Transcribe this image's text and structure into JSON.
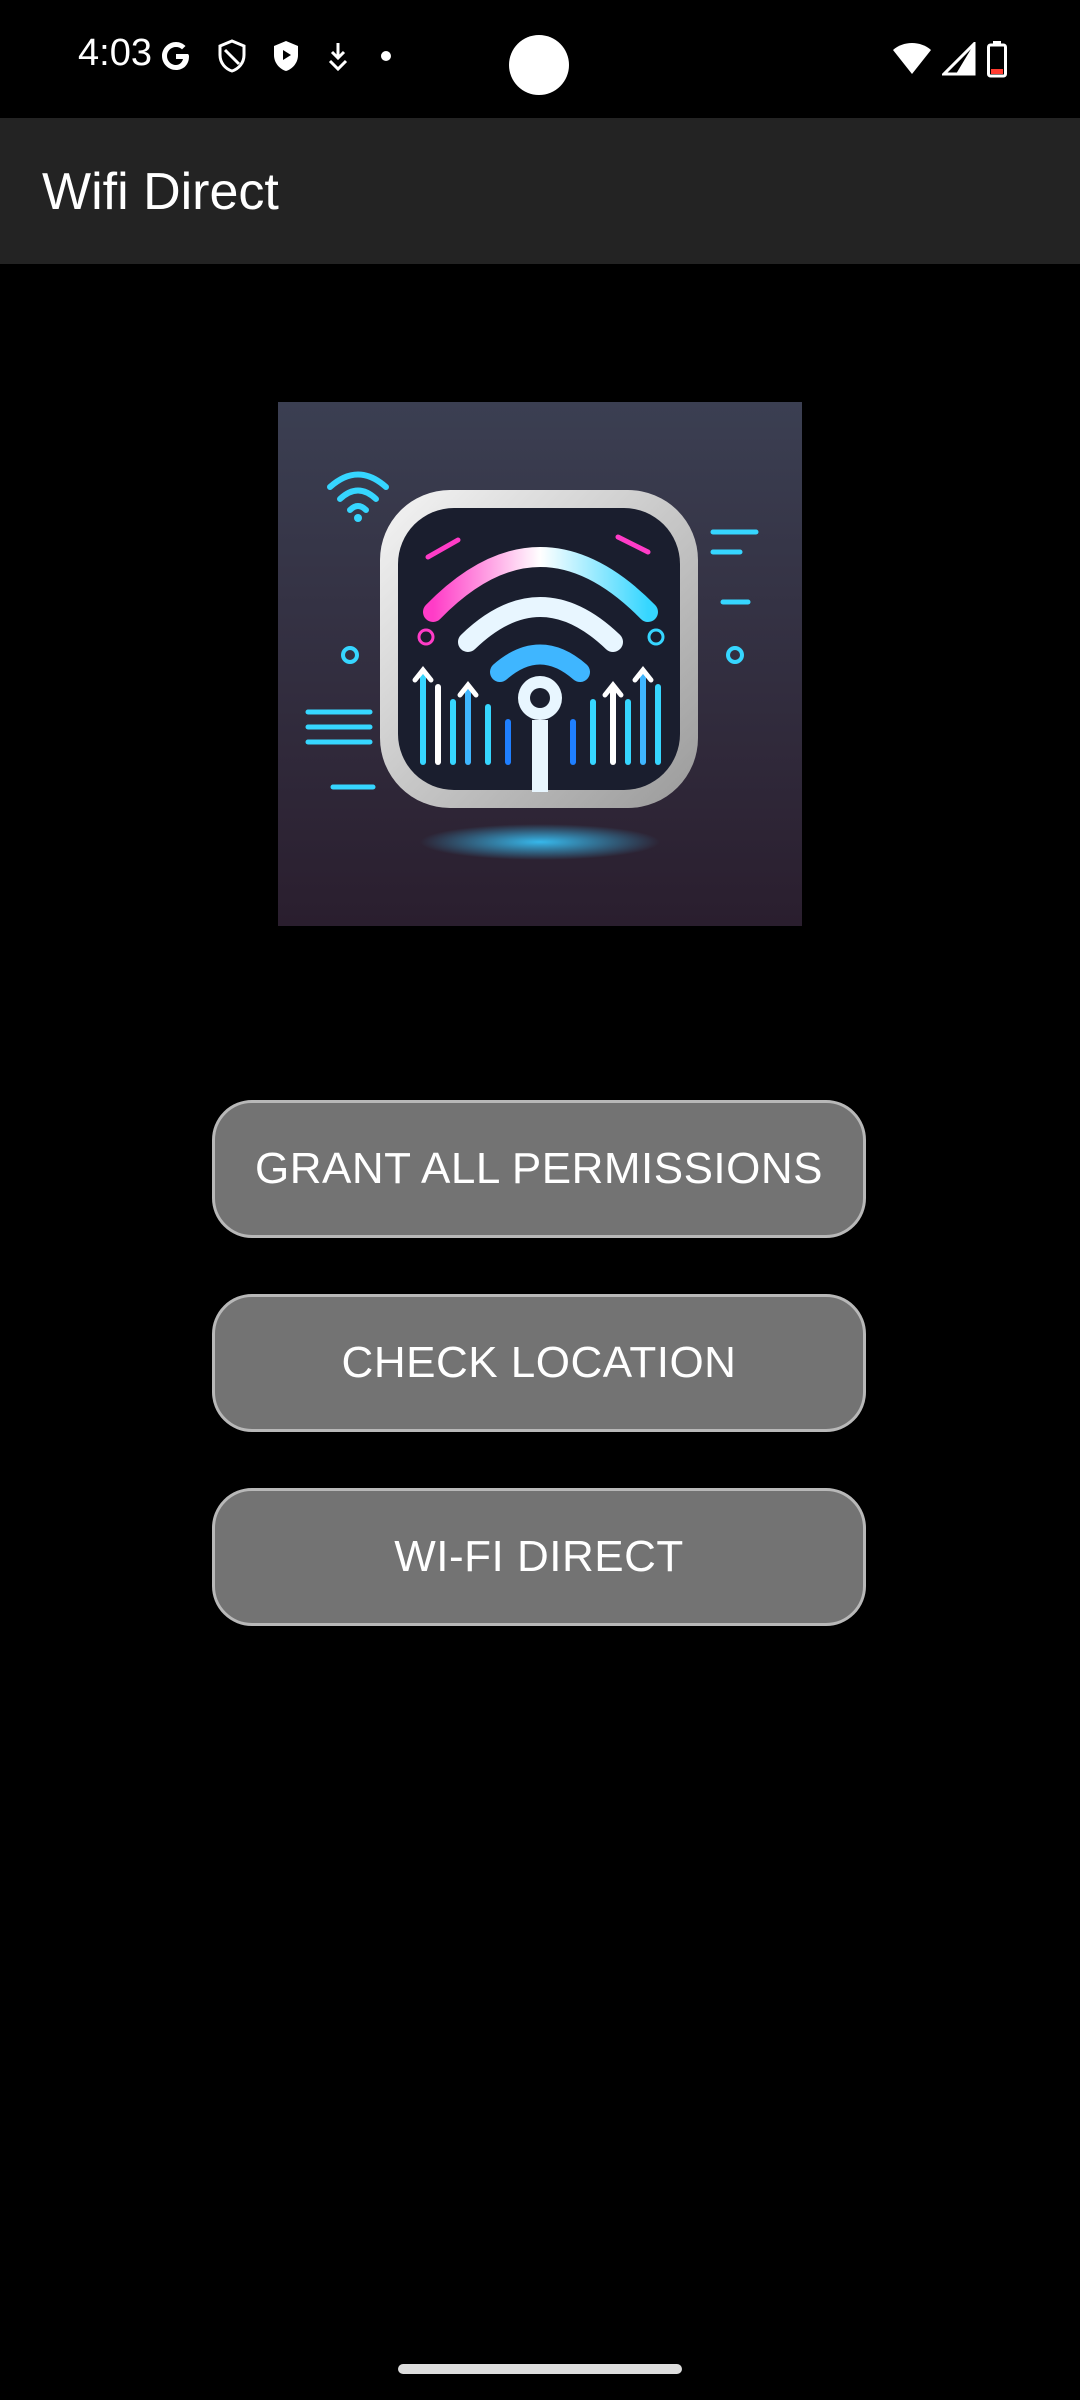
{
  "status_bar": {
    "time": "4:03",
    "left_icons": [
      "google-g-icon",
      "shield-outline-icon",
      "shield-filled-icon",
      "download-arrow-icon",
      "dot-icon"
    ],
    "right_icons": [
      "wifi-icon",
      "cell-signal-icon",
      "battery-icon"
    ]
  },
  "app_bar": {
    "title": "Wifi Direct"
  },
  "logo": {
    "description_icon": "wifi-direct-logo"
  },
  "buttons": {
    "grant_permissions": "GRANT ALL PERMISSIONS",
    "check_location": "CHECK LOCATION",
    "wifi_direct": "WI-FI DIRECT"
  },
  "colors": {
    "background": "#000000",
    "app_bar": "#232323",
    "button_fill": "#737373",
    "button_border": "#b8b8b8",
    "accent_cyan": "#2ee6ff",
    "accent_magenta": "#ff2fb5"
  }
}
